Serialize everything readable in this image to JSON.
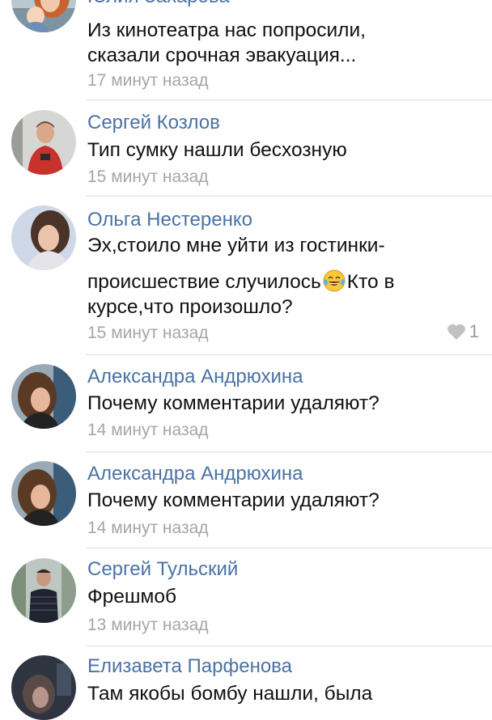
{
  "comments": [
    {
      "author": "Юлия Захарова",
      "lines": [
        "Из кинотеатра нас попросили,",
        "сказали срочная эвакуация..."
      ],
      "time": "17 минут назад",
      "avatar": "avatar-photo-woman-with-child"
    },
    {
      "author": "Сергей Козлов",
      "lines": [
        "Тип сумку нашли бесхозную"
      ],
      "time": "15 минут назад",
      "avatar": "avatar-photo-man-red-shirt"
    },
    {
      "author": "Ольга Нестеренко",
      "line1": "Эх,стоило мне уйти из гостинки-",
      "line2_before": "происшествие случилось",
      "line2_emoji": "tears-of-joy-emoji",
      "line2_after": "Кто в",
      "line3": "курсе,что произошло?",
      "time": "15 минут назад",
      "likes": "1",
      "avatar": "avatar-photo-woman-dark-hair"
    },
    {
      "author": "Александра Андрюхина",
      "lines": [
        "Почему комментарии удаляют?"
      ],
      "time": "14 минут назад",
      "avatar": "avatar-photo-girl"
    },
    {
      "author": "Александра Андрюхина",
      "lines": [
        "Почему комментарии удаляют?"
      ],
      "time": "14 минут назад",
      "avatar": "avatar-photo-girl"
    },
    {
      "author": "Сергей Тульский",
      "lines": [
        "Фрешмоб"
      ],
      "time": "13 минут назад",
      "avatar": "avatar-photo-man-black-jacket"
    },
    {
      "author": "Елизавета Парфенова",
      "lines": [
        "Там якобы бомбу нашли, была"
      ],
      "time": "",
      "avatar": "avatar-photo-dark"
    }
  ],
  "colors": {
    "author_name": "#4a72a5",
    "comment_text": "#111111",
    "timestamp": "#a6a6a6",
    "divider": "#dcdcdc",
    "like_icon": "#c2c2c2"
  }
}
